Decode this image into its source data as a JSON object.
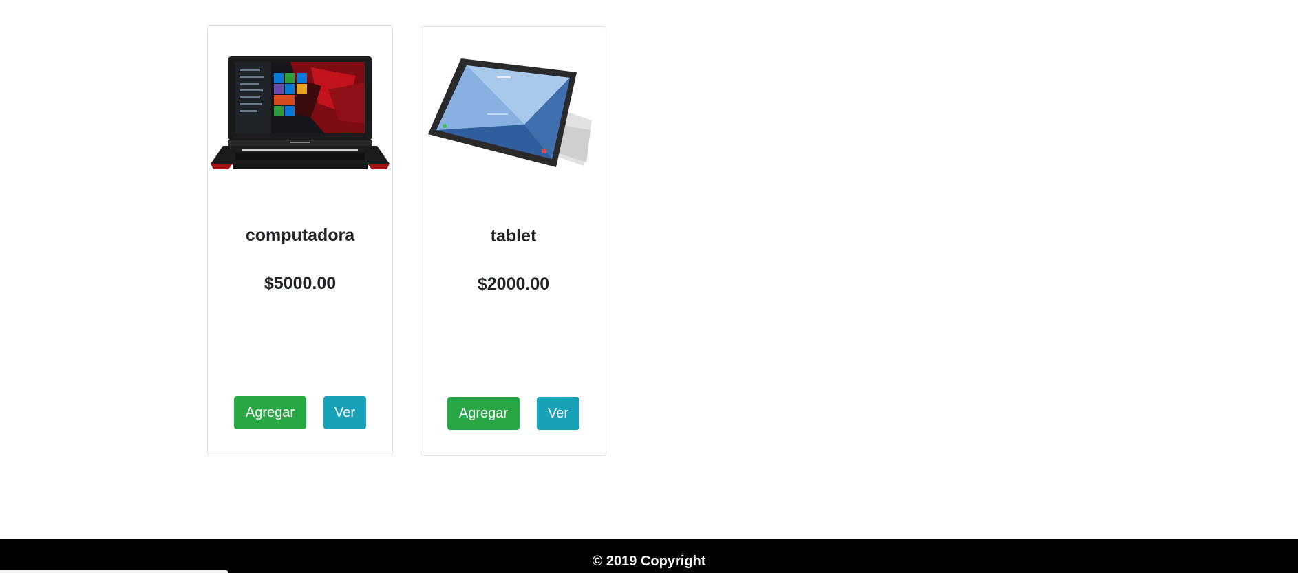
{
  "products": [
    {
      "name": "computadora",
      "price": "$5000.00",
      "image": "laptop-image",
      "add_label": "Agregar",
      "view_label": "Ver"
    },
    {
      "name": "tablet",
      "price": "$2000.00",
      "image": "tablet-image",
      "add_label": "Agregar",
      "view_label": "Ver"
    }
  ],
  "footer": {
    "text": "© 2019 Copyright"
  },
  "colors": {
    "add_button": "#28a745",
    "view_button": "#17a2b8",
    "footer_bg": "#000000",
    "card_border": "#dee2e6"
  }
}
